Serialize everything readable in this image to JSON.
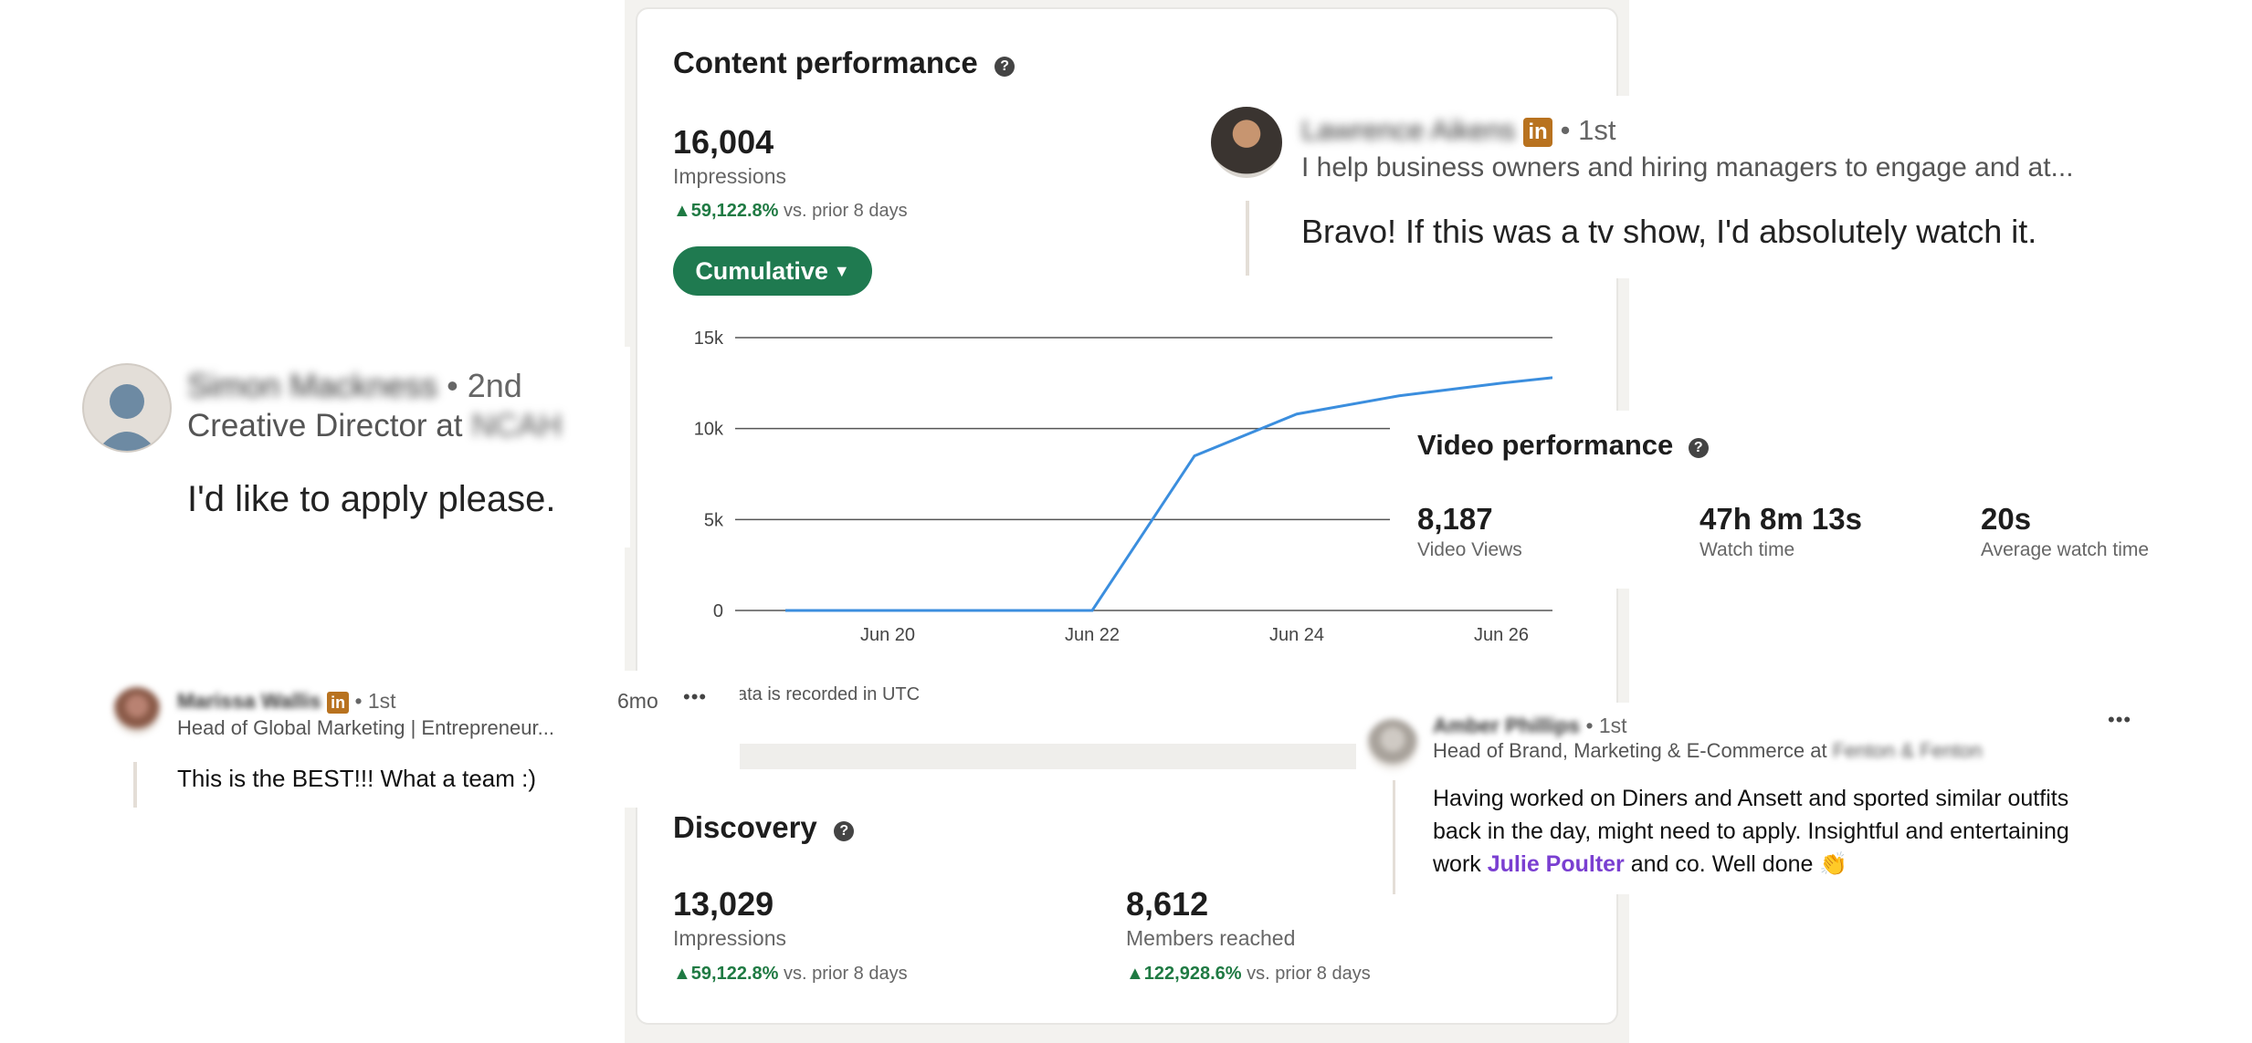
{
  "content_performance": {
    "title": "Content performance",
    "impressions_value": "16,004",
    "impressions_label": "Impressions",
    "trend_value": "59,122.8%",
    "trend_text": "vs. prior 8 days",
    "dropdown_label": "Cumulative",
    "utc_note": "ata is recorded in UTC"
  },
  "chart_data": {
    "type": "line",
    "x": [
      "Jun 19",
      "Jun 20",
      "Jun 21",
      "Jun 22",
      "Jun 23",
      "Jun 24",
      "Jun 25",
      "Jun 26",
      "Jun 27"
    ],
    "y_ticks": [
      "0",
      "5k",
      "10k",
      "15k"
    ],
    "x_ticks": [
      "Jun 20",
      "Jun 22",
      "Jun 24",
      "Jun 26"
    ],
    "ylim": [
      0,
      15000
    ],
    "series": [
      {
        "values": [
          0,
          0,
          0,
          0,
          8500,
          10800,
          11800,
          12500,
          13100
        ],
        "color": "#3b8ede"
      }
    ],
    "grid": true
  },
  "discovery": {
    "title": "Discovery",
    "impressions_value": "13,029",
    "impressions_label": "Impressions",
    "impressions_trend_value": "59,122.8%",
    "impressions_trend_text": "vs. prior 8 days",
    "members_value": "8,612",
    "members_label": "Members reached",
    "members_trend_value": "122,928.6%",
    "members_trend_text": "vs. prior 8 days"
  },
  "video_performance": {
    "title": "Video performance",
    "stats": [
      {
        "value": "8,187",
        "label": "Video Views"
      },
      {
        "value": "47h 8m 13s",
        "label": "Watch time"
      },
      {
        "value": "20s",
        "label": "Average watch time"
      }
    ]
  },
  "comments": {
    "lawrence": {
      "name": "Lawrence Aikens",
      "degree": "• 1st",
      "headline": "I help business owners and hiring managers to engage and at...",
      "text": "Bravo! If this was a tv show, I'd absolutely watch it."
    },
    "simon": {
      "name": "Simon Mackness",
      "degree": "• 2nd",
      "headline": "Creative Director at",
      "company": "NCAH",
      "text": "I'd like to apply please."
    },
    "marissa": {
      "name": "Marissa Wallis",
      "degree": "• 1st",
      "headline": "Head of Global Marketing | Entrepreneur...",
      "time": "6mo",
      "more": "•••",
      "text": "This is the BEST!!! What a team :)"
    },
    "amber": {
      "name": "Amber Phillips",
      "degree": "• 1st",
      "headline": "Head of Brand, Marketing & E-Commerce at",
      "company": "Fenton & Fenton",
      "more": "•••",
      "text_before": "Having worked on Diners and Ansett and sported similar outfits back in the day, might need to apply. Insightful and entertaining work",
      "mention": "Julie Poulter",
      "text_after": "and co. Well done",
      "emoji": "👏"
    }
  },
  "colors": {
    "accent_green": "#1f7a50",
    "line_blue": "#3b8ede",
    "mention_purple": "#7a3fd1",
    "linkedin_badge": "#b8721f"
  },
  "icons": [
    "help-icon",
    "caret-down-icon",
    "trend-up-icon",
    "linkedin-icon",
    "more-icon",
    "clap-emoji"
  ]
}
